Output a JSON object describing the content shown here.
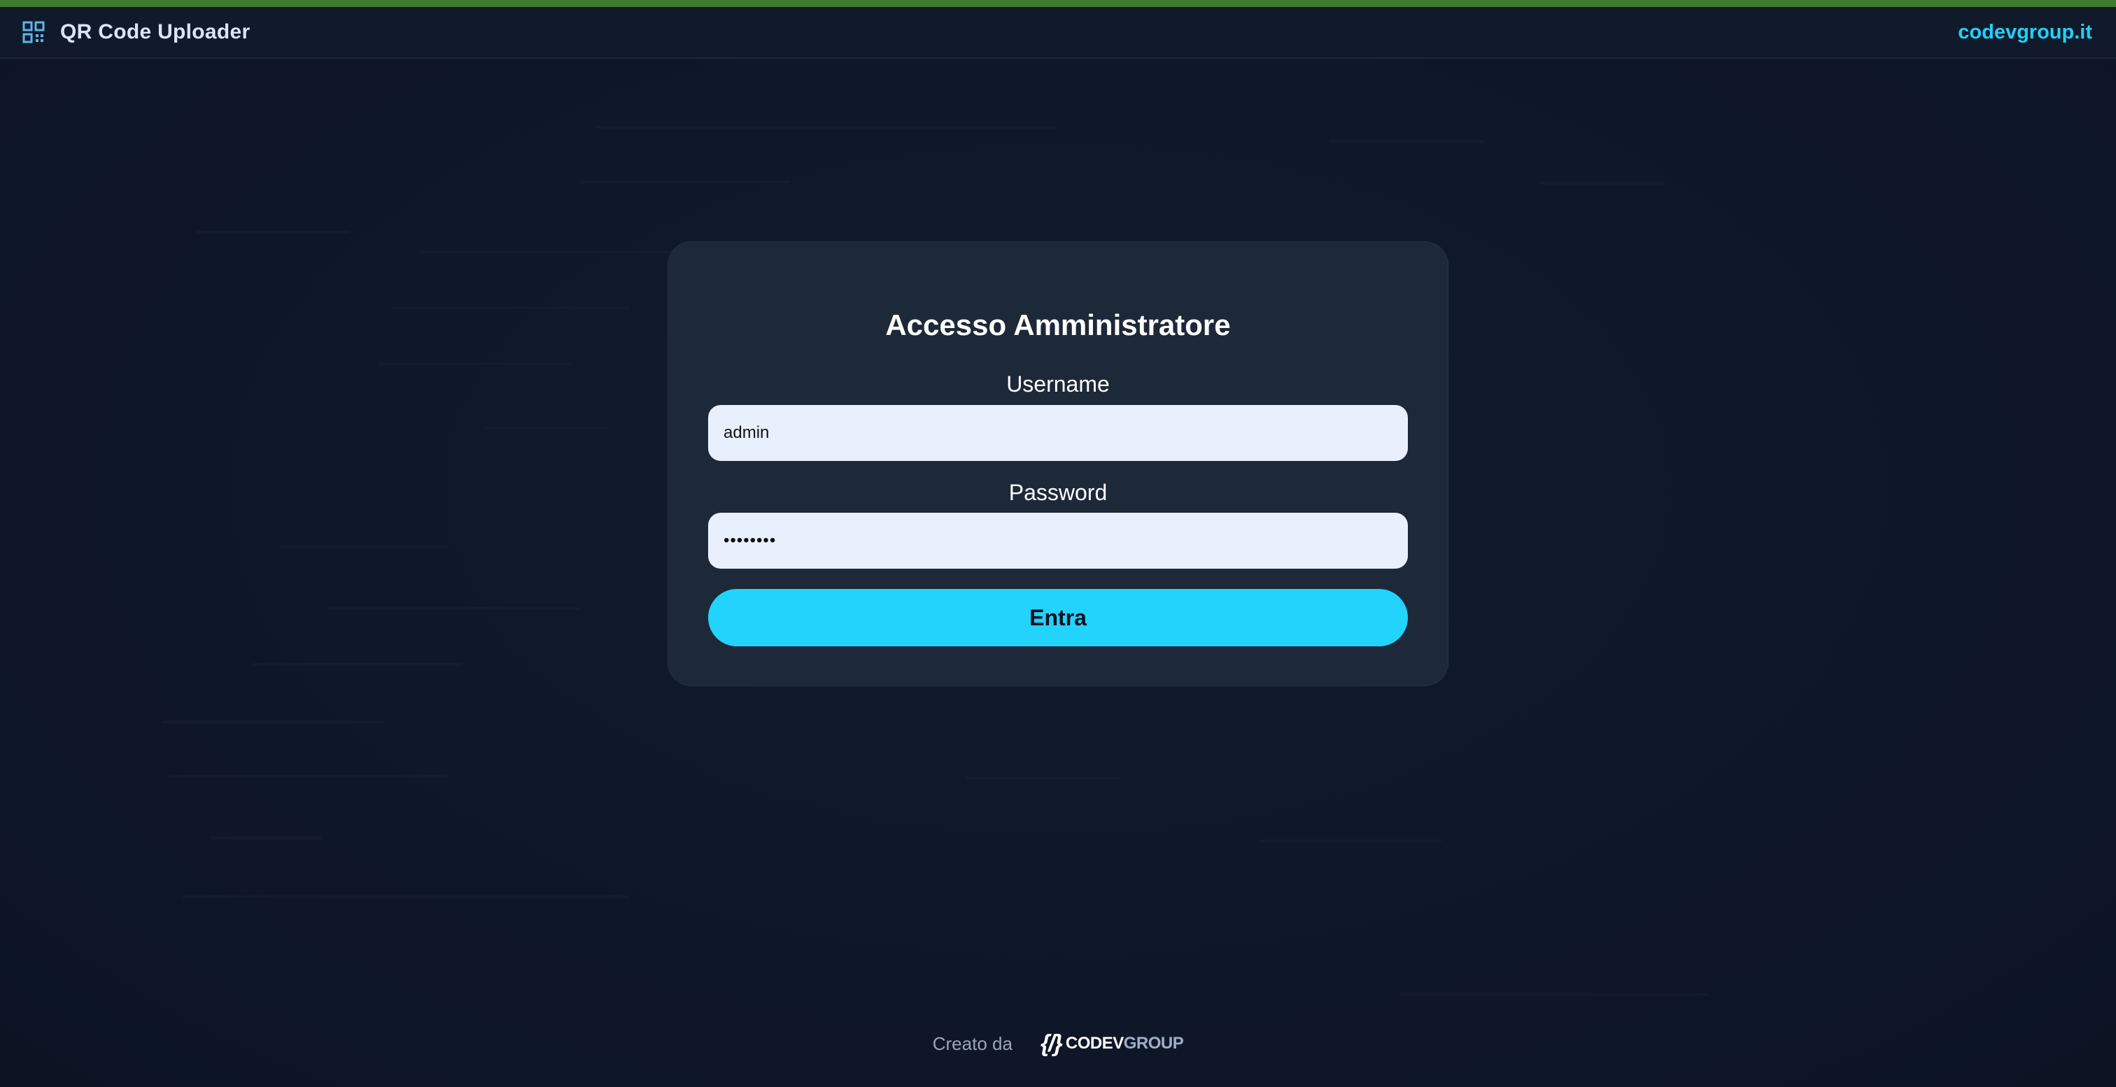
{
  "header": {
    "app_title": "QR Code Uploader",
    "app_icon": "qr-code-icon",
    "site_link": "codevgroup.it"
  },
  "login": {
    "title": "Accesso Amministratore",
    "username_label": "Username",
    "username_value": "admin",
    "password_label": "Password",
    "password_value": "••••••••",
    "submit_label": "Entra"
  },
  "footer": {
    "created_by": "Creato da",
    "logo_mark": "{/}",
    "logo_part1": "CODEV",
    "logo_part2": "GROUP"
  },
  "colors": {
    "accent": "#22d3fb",
    "background": "#0f1829",
    "card": "#1d2939"
  }
}
